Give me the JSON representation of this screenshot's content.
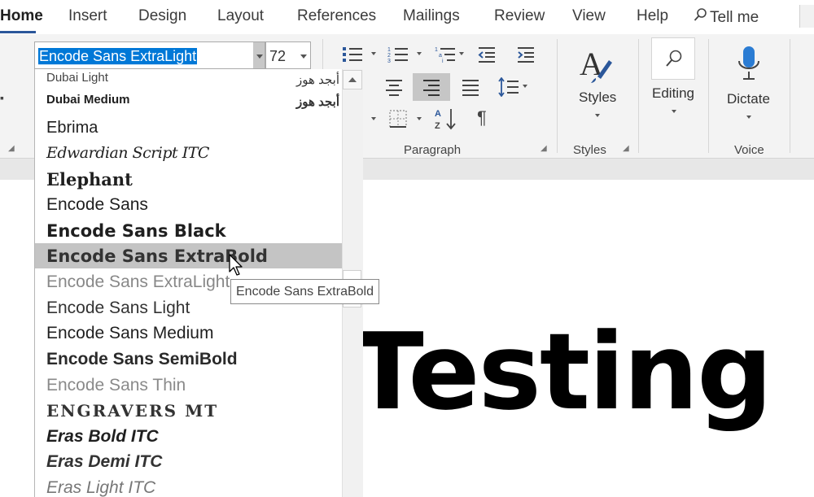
{
  "tabs": [
    {
      "label": "Home",
      "active": true
    },
    {
      "label": "Insert"
    },
    {
      "label": "Design"
    },
    {
      "label": "Layout"
    },
    {
      "label": "References"
    },
    {
      "label": "Mailings"
    },
    {
      "label": "Review"
    },
    {
      "label": "View"
    },
    {
      "label": "Help"
    }
  ],
  "tellme": "Tell me",
  "font": {
    "current": "Encode Sans ExtraLight",
    "size": "72"
  },
  "groups": {
    "paragraph": "Paragraph",
    "styles": "Styles",
    "voice": "Voice"
  },
  "buttons": {
    "styles": "Styles",
    "editing": "Editing",
    "dictate": "Dictate"
  },
  "font_list": [
    {
      "name": "Dubai Light",
      "preview": "أبجد هوز"
    },
    {
      "name": "Dubai Medium",
      "preview": "أبجد هوز"
    },
    {
      "name": "Ebrima"
    },
    {
      "name": "Edwardian Script ITC"
    },
    {
      "name": "Elephant"
    },
    {
      "name": "Encode Sans"
    },
    {
      "name": "Encode Sans Black"
    },
    {
      "name": "Encode Sans ExtraBold",
      "hovered": true
    },
    {
      "name": "Encode Sans ExtraLight"
    },
    {
      "name": "Encode Sans Light"
    },
    {
      "name": "Encode Sans Medium"
    },
    {
      "name": "Encode Sans SemiBold"
    },
    {
      "name": "Encode Sans Thin"
    },
    {
      "name": "ENGRAVERS MT"
    },
    {
      "name": "Eras Bold ITC"
    },
    {
      "name": "Eras Demi ITC"
    },
    {
      "name": "Eras Light ITC"
    }
  ],
  "tooltip": "Encode Sans ExtraBold",
  "document": {
    "text": "Testing"
  },
  "colors": {
    "accent": "#2b579a",
    "selection": "#0078d7"
  }
}
